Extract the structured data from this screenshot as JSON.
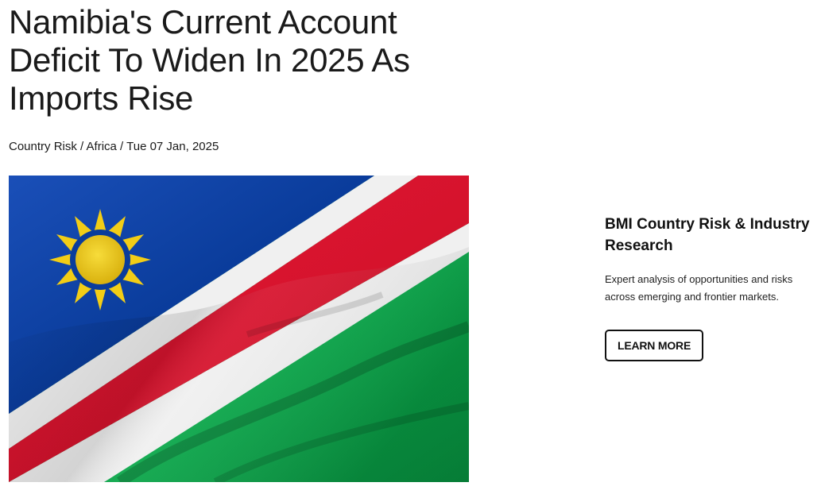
{
  "article": {
    "title": "Namibia's Current Account Deficit To Widen In 2025 As Imports Rise",
    "breadcrumb": {
      "section": "Country Risk",
      "region": "Africa",
      "separator": " / ",
      "date": "Tue 07 Jan, 2025"
    },
    "hero_image": {
      "subject": "namibia-flag"
    }
  },
  "promo": {
    "title": "BMI Country Risk & Industry Research",
    "text": "Expert analysis of opportunities and risks across emerging and frontier markets.",
    "button_label": "LEARN MORE"
  },
  "colors": {
    "flag_blue": "#0a3c9b",
    "flag_red": "#d6132c",
    "flag_green": "#0aa84a",
    "flag_white": "#f2f2f2",
    "flag_sun": "#f2cd16"
  }
}
